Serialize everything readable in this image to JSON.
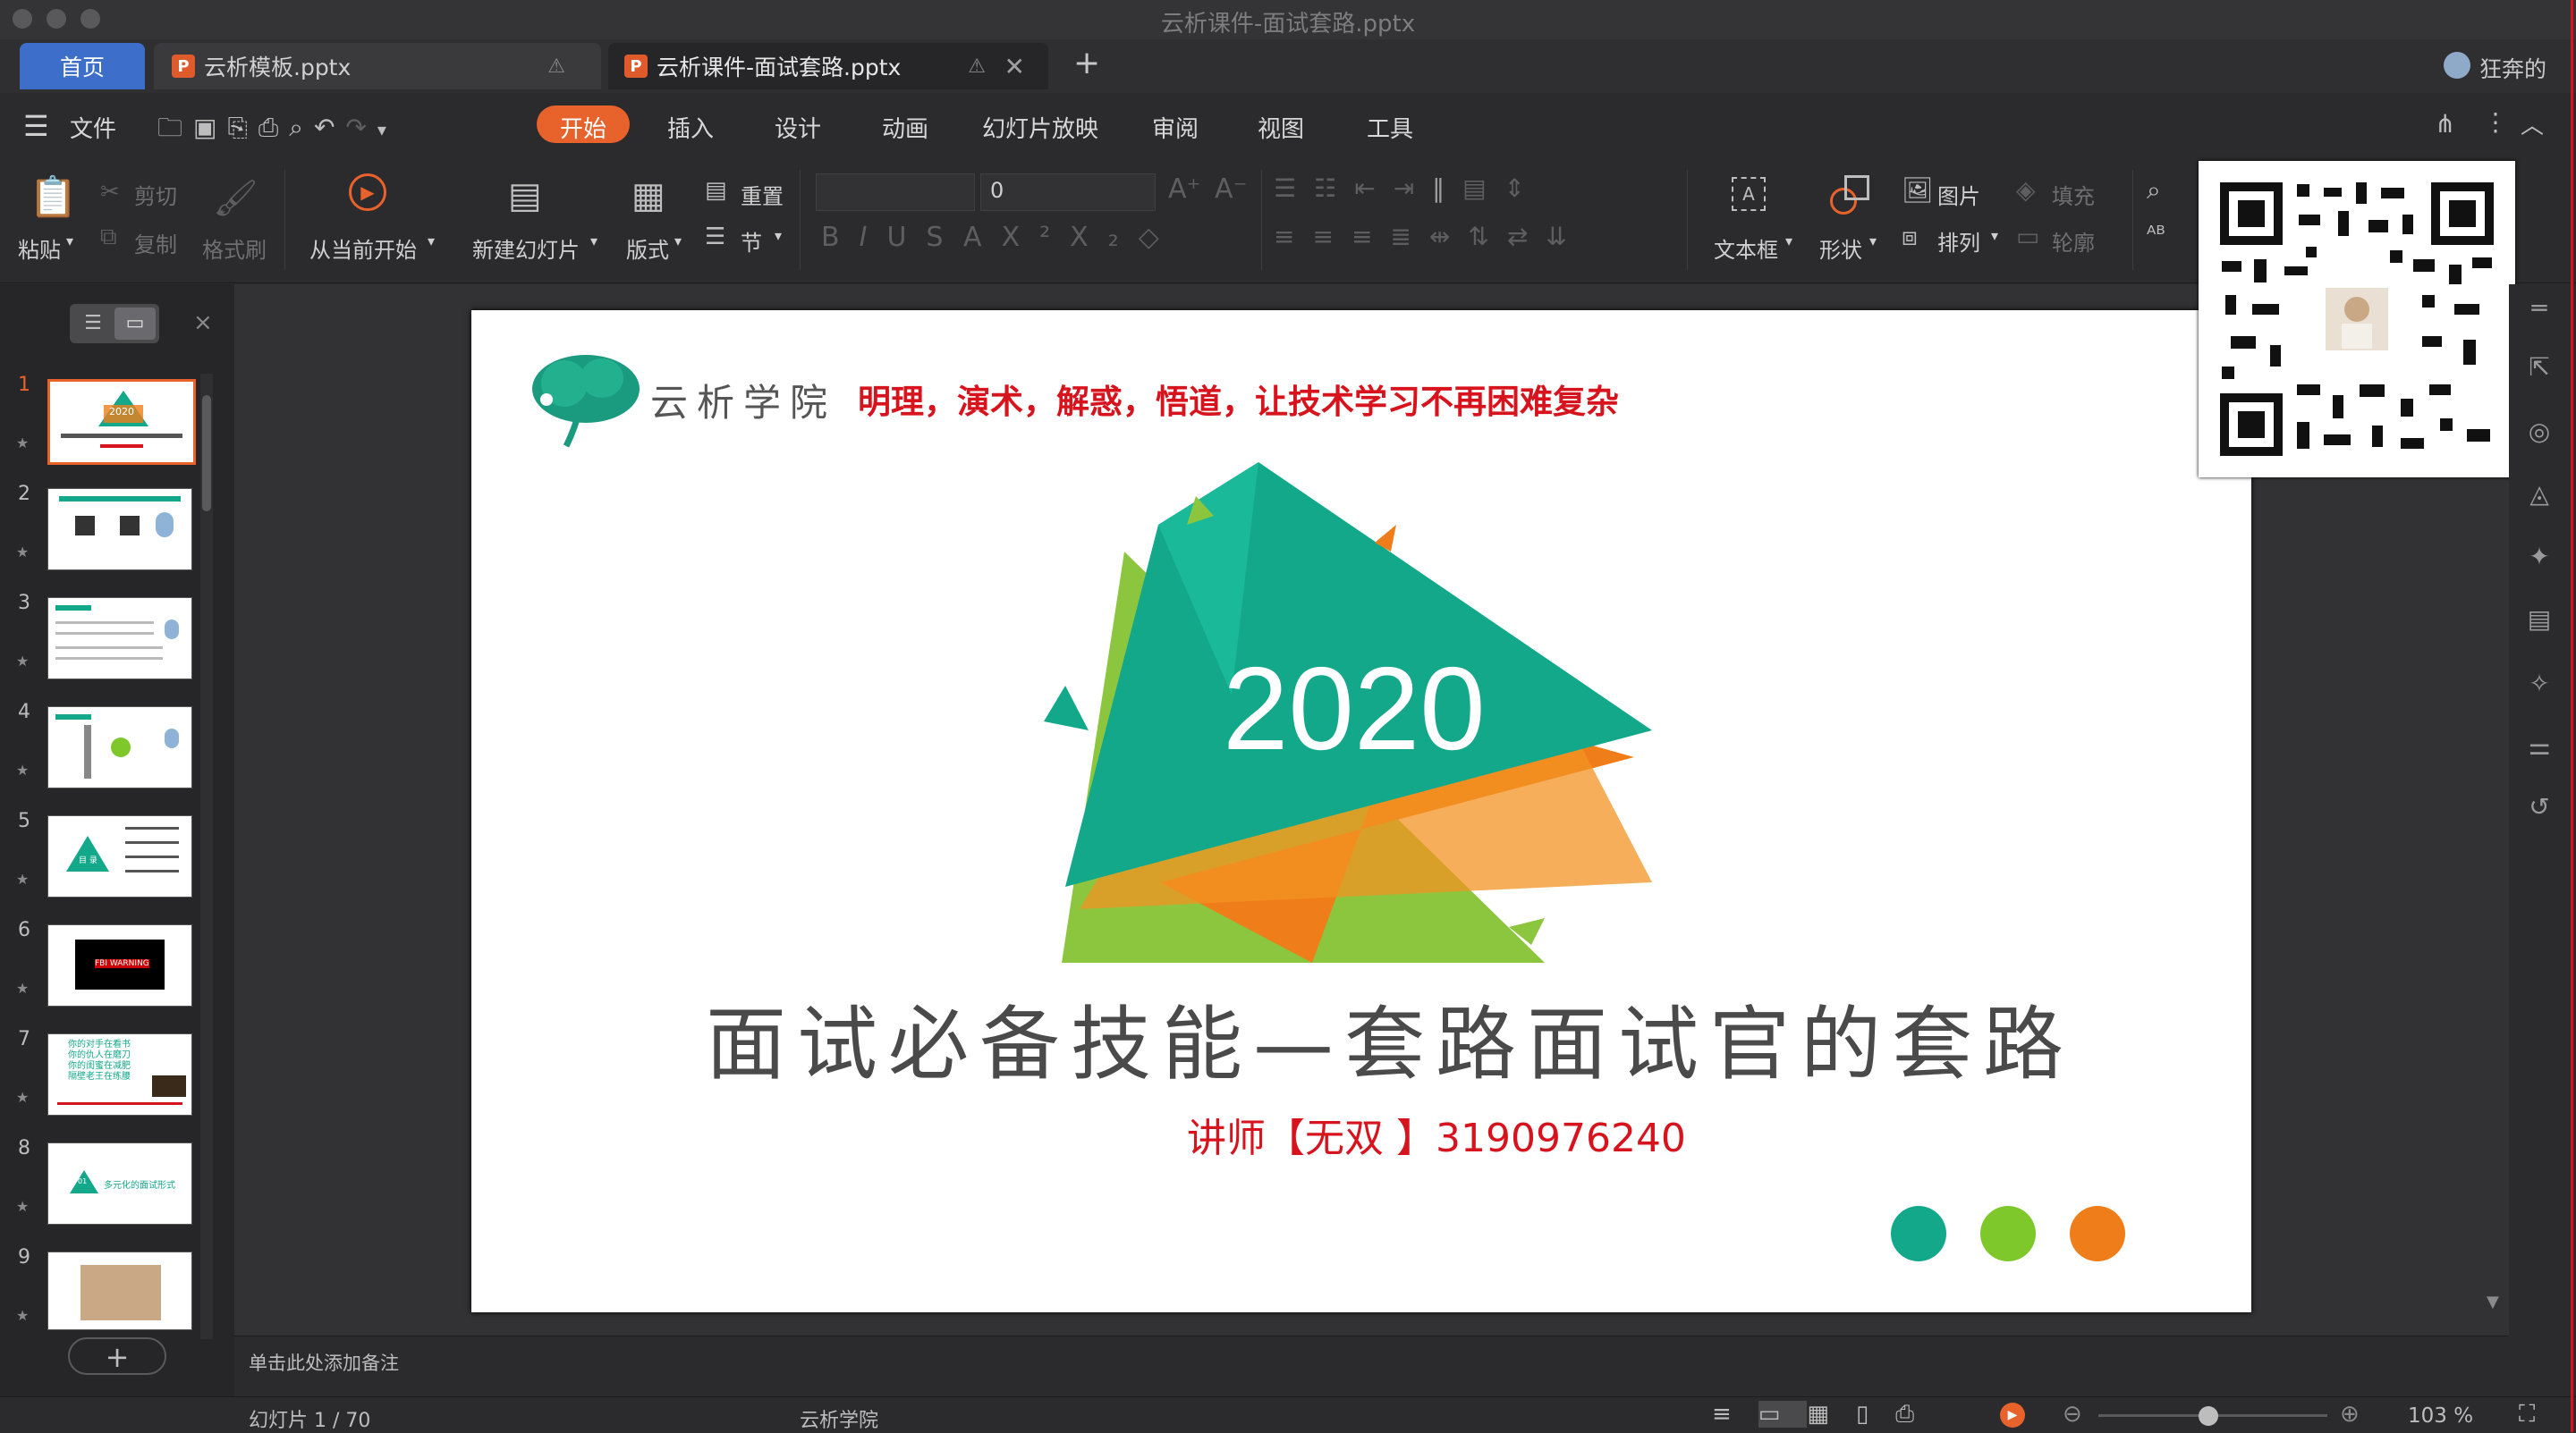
{
  "window": {
    "title": "云析课件-面试套路.pptx"
  },
  "tabs": [
    {
      "label": "首页"
    },
    {
      "label": "云析模板.pptx"
    },
    {
      "label": "云析课件-面试套路.pptx"
    }
  ],
  "user": {
    "name": "狂奔的"
  },
  "menu": {
    "file": "文件",
    "items": [
      "开始",
      "插入",
      "设计",
      "动画",
      "幻灯片放映",
      "审阅",
      "视图",
      "工具"
    ],
    "active": "开始"
  },
  "ribbon": {
    "paste": "粘贴",
    "cut": "剪切",
    "copy": "复制",
    "format_painter": "格式刷",
    "from_current": "从当前开始",
    "new_slide": "新建幻灯片",
    "layout": "版式",
    "reset": "重置",
    "section": "节",
    "font_size": "0",
    "textbox": "文本框",
    "shape": "形状",
    "picture": "图片",
    "arrange": "排列",
    "fill": "填充",
    "outline": "轮廓"
  },
  "slide": {
    "brand": "云析学院",
    "slogan": "明理，演术，解惑，悟道，让技术学习不再困难复杂",
    "year": "2020",
    "title": "面试必备技能—套路面试官的套路",
    "lecturer": "讲师【无双 】3190976240",
    "dot_colors": [
      "#14a88a",
      "#7ec82c",
      "#ef7d1a"
    ]
  },
  "thumbnails": {
    "numbers": [
      "1",
      "2",
      "3",
      "4",
      "5",
      "6",
      "7",
      "8",
      "9"
    ],
    "t6_text": "FBI WARNING",
    "t8_text": "多元化的面试形式",
    "t8_num": "01",
    "t5_label": "目 录",
    "t7_lines": [
      "你的对手在看书",
      "你的仇人在磨刀",
      "你的闺蜜在减肥",
      "隔壁老王在练腰"
    ]
  },
  "notes": {
    "placeholder": "单击此处添加备注"
  },
  "status": {
    "slide_info": "幻灯片 1 / 70",
    "theme": "云析学院",
    "zoom": "103 %",
    "zoom_fraction": 0.48
  },
  "colors": {
    "accent_orange": "#e8622c",
    "teal": "#14a88a",
    "green": "#7ec82c",
    "orange": "#ef7d1a",
    "red_text": "#d7141e"
  }
}
